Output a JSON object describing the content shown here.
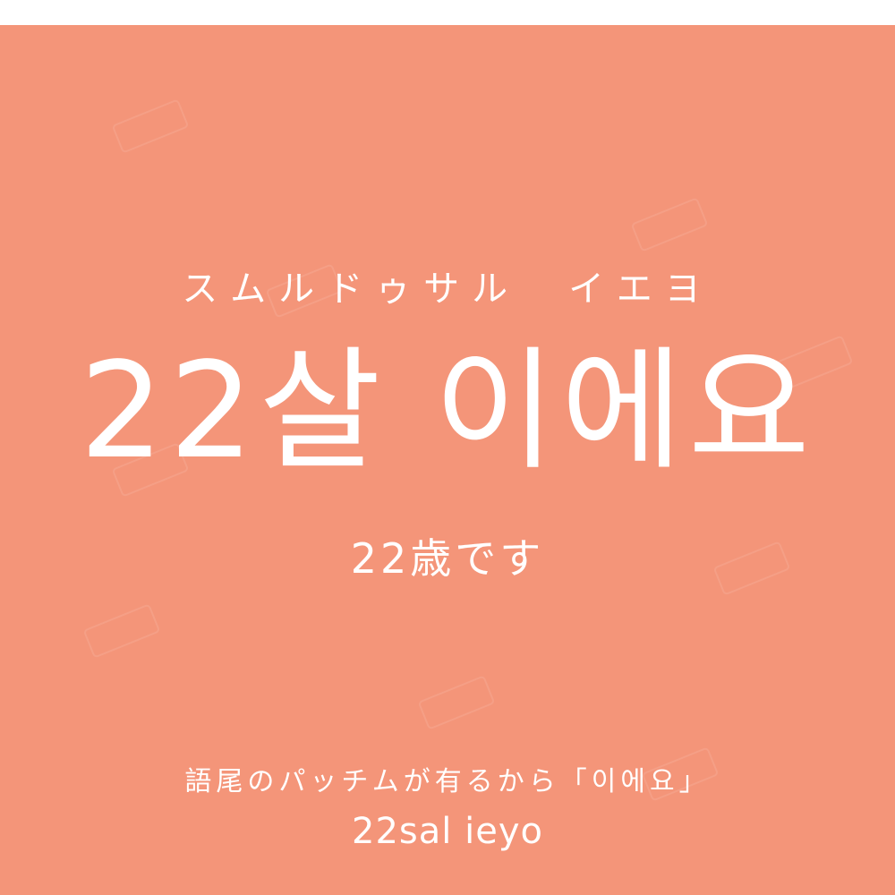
{
  "card": {
    "background_color": "#f49579",
    "text_color": "#ffffff",
    "kana_reading": "スムルドゥサル　イエヨ",
    "headline": "22살 이에요",
    "translation": "22歳です",
    "note": "語尾のパッチムが有るから「이에요」",
    "romanization": "22sal ieyo"
  }
}
